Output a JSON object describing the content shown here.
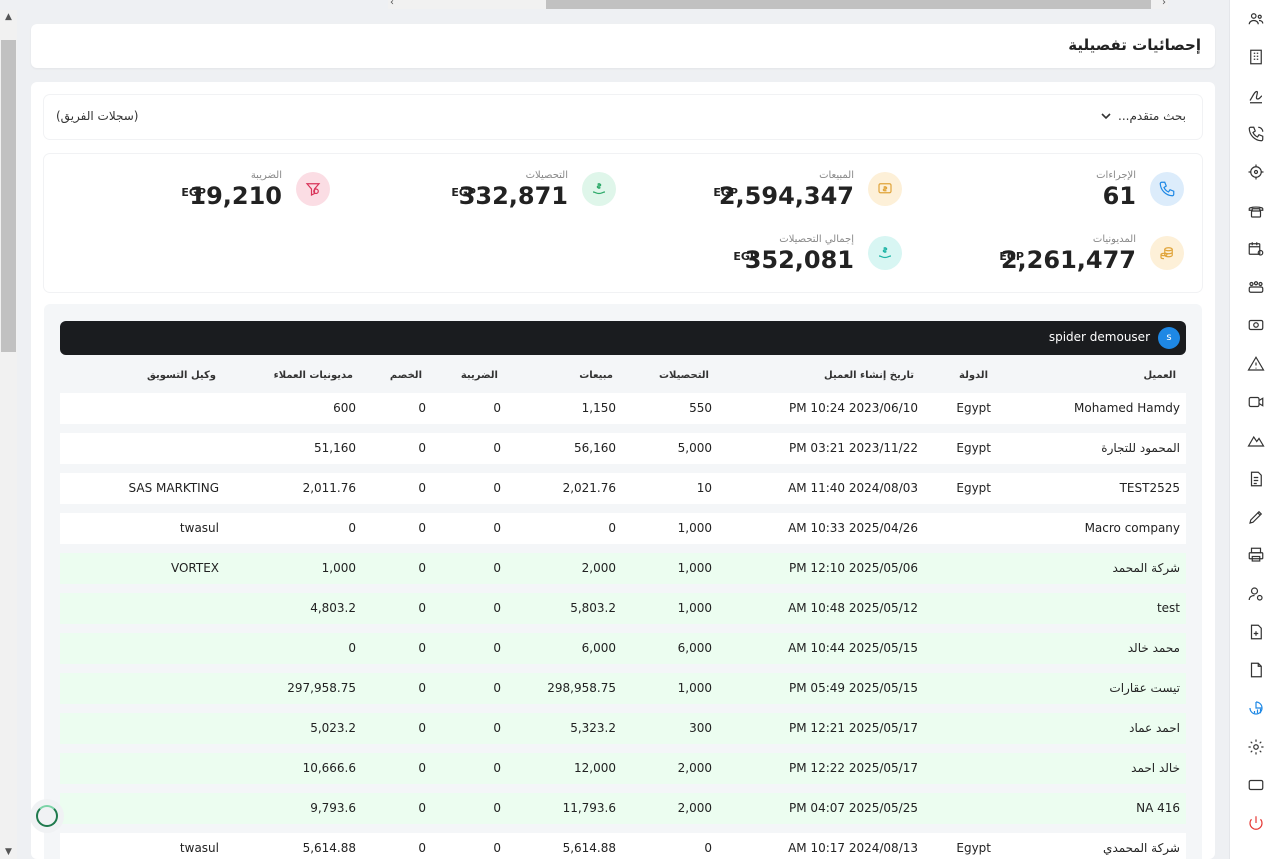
{
  "page_title": "إحصائيات تفصيلية",
  "filter": {
    "advanced_search": "بحث متقدم...",
    "team_records": "(سجلات الفريق)"
  },
  "stats": {
    "actions": {
      "label": "الإجراءات",
      "value": "61"
    },
    "sales": {
      "label": "المبيعات",
      "value": "2,594,347",
      "currency": "EGP"
    },
    "collections": {
      "label": "التحصيلات",
      "value": "332,871",
      "currency": "EGP"
    },
    "tax": {
      "label": "الضريبة",
      "value": "19,210",
      "currency": "EGP"
    },
    "debts": {
      "label": "المديونيات",
      "value": "2,261,477",
      "currency": "EGP"
    },
    "total_collections": {
      "label": "إجمالي التحصيلات",
      "value": "352,081",
      "currency": "EGP"
    }
  },
  "user": {
    "name": "spider demouser",
    "initial": "s"
  },
  "table": {
    "headers": {
      "client": "العميل",
      "country": "الدولة",
      "created": "تاريخ إنشاء العميل",
      "collections": "التحصيلات",
      "sales": "مبيعات",
      "tax": "الضريبة",
      "discount": "الخصم",
      "debts": "مديونيات العملاء",
      "agent": "وكيل التسويق"
    },
    "rows": [
      {
        "client": "Mohamed Hamdy",
        "country": "Egypt",
        "created": "PM 10:24 2023/06/10",
        "collections": "550",
        "sales": "1,150",
        "tax": "0",
        "discount": "0",
        "debts": "600",
        "agent": ""
      },
      {
        "client": "المحمود للتجارة",
        "country": "Egypt",
        "created": "PM 03:21 2023/11/22",
        "collections": "5,000",
        "sales": "56,160",
        "tax": "0",
        "discount": "0",
        "debts": "51,160",
        "agent": ""
      },
      {
        "client": "TEST2525",
        "country": "Egypt",
        "created": "AM 11:40 2024/08/03",
        "collections": "10",
        "sales": "2,021.76",
        "tax": "0",
        "discount": "0",
        "debts": "2,011.76",
        "agent": "SAS MARKTING"
      },
      {
        "client": "Macro company",
        "country": "",
        "created": "AM 10:33 2025/04/26",
        "collections": "1,000",
        "sales": "0",
        "tax": "0",
        "discount": "0",
        "debts": "0",
        "agent": "twasul"
      },
      {
        "client": "شركة المحمد",
        "country": "",
        "created": "PM 12:10 2025/05/06",
        "collections": "1,000",
        "sales": "2,000",
        "tax": "0",
        "discount": "0",
        "debts": "1,000",
        "agent": "VORTEX"
      },
      {
        "client": "test",
        "country": "",
        "created": "AM 10:48 2025/05/12",
        "collections": "1,000",
        "sales": "5,803.2",
        "tax": "0",
        "discount": "0",
        "debts": "4,803.2",
        "agent": ""
      },
      {
        "client": "محمد خالد",
        "country": "",
        "created": "AM 10:44 2025/05/15",
        "collections": "6,000",
        "sales": "6,000",
        "tax": "0",
        "discount": "0",
        "debts": "0",
        "agent": ""
      },
      {
        "client": "تيست عقارات",
        "country": "",
        "created": "PM 05:49 2025/05/15",
        "collections": "1,000",
        "sales": "298,958.75",
        "tax": "0",
        "discount": "0",
        "debts": "297,958.75",
        "agent": ""
      },
      {
        "client": "احمد عماد",
        "country": "",
        "created": "PM 12:21 2025/05/17",
        "collections": "300",
        "sales": "5,323.2",
        "tax": "0",
        "discount": "0",
        "debts": "5,023.2",
        "agent": ""
      },
      {
        "client": "خالد احمد",
        "country": "",
        "created": "PM 12:22 2025/05/17",
        "collections": "2,000",
        "sales": "12,000",
        "tax": "0",
        "discount": "0",
        "debts": "10,666.6",
        "agent": ""
      },
      {
        "client": "NA 416",
        "country": "",
        "created": "PM 04:07 2025/05/25",
        "collections": "2,000",
        "sales": "11,793.6",
        "tax": "0",
        "discount": "0",
        "debts": "9,793.6",
        "agent": ""
      },
      {
        "client": "شركة المحمدي",
        "country": "Egypt",
        "created": "AM 10:17 2024/08/13",
        "collections": "0",
        "sales": "5,614.88",
        "tax": "0",
        "discount": "0",
        "debts": "5,614.88",
        "agent": "twasul"
      }
    ]
  },
  "sidebar_icons": [
    "users-icon",
    "building-icon",
    "signature-icon",
    "phone-call-icon",
    "target-icon",
    "telephone-icon",
    "calendar-settings-icon",
    "team-icon",
    "money-icon",
    "warning-icon",
    "video-call-icon",
    "mountain-icon",
    "invoice-icon",
    "pen-icon",
    "printer-icon",
    "user-settings-icon",
    "add-doc-icon",
    "document-icon",
    "analytics-icon",
    "settings-icon",
    "window-icon",
    "power-icon"
  ],
  "colors": {
    "accent": "#1e88e5",
    "green_row": "#ecfdf0",
    "dark_bar": "#1a1c1f"
  }
}
